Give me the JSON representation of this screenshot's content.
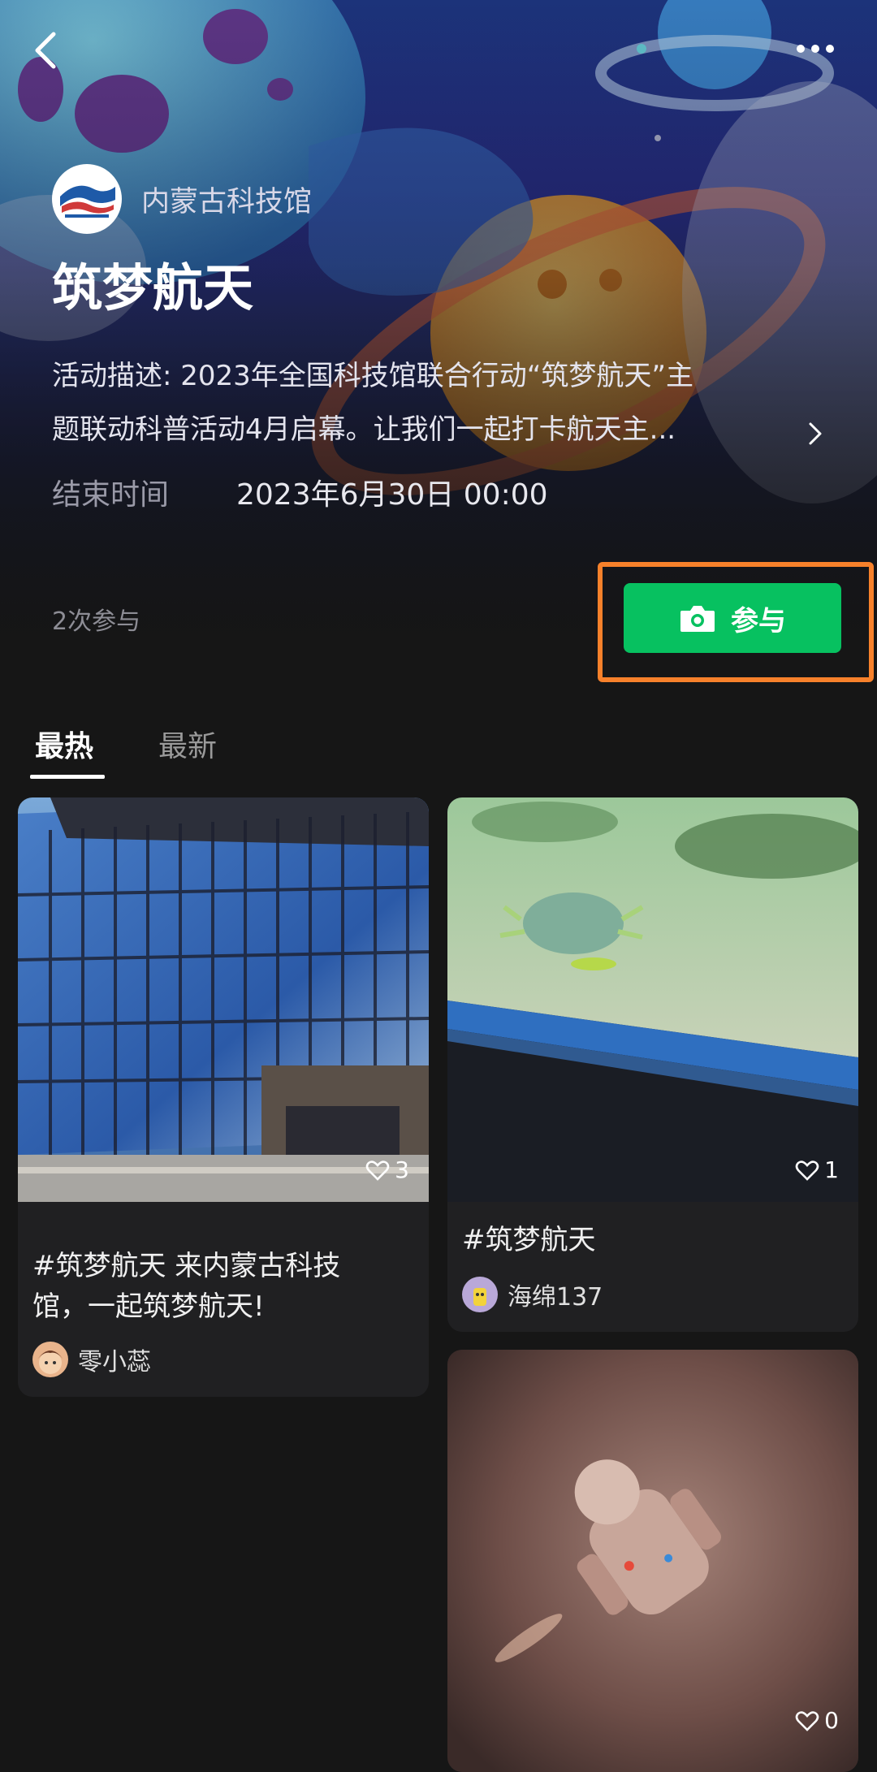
{
  "header": {
    "back_icon": "chevron-left-icon",
    "more_icon": "more-horizontal-icon"
  },
  "activity": {
    "organizer": "内蒙古科技馆",
    "title": "筑梦航天",
    "description_line1": "活动描述: 2023年全国科技馆联合行动“筑梦航天”主",
    "description_line2": "题联动科普活动4月启幕。让我们一起打卡航天主...",
    "end_time_label": "结束时间",
    "end_time_value": "2023年6月30日 00:00",
    "participation_count": "2次参与",
    "join_label": "参与"
  },
  "tabs": [
    {
      "label": "最热",
      "active": true
    },
    {
      "label": "最新",
      "active": false
    }
  ],
  "posts": [
    {
      "caption_line1": "#筑梦航天 来内蒙古科技",
      "caption_line2": "馆，一起筑梦航天!",
      "author": "零小蕊",
      "likes": "3"
    },
    {
      "caption_line1": "#筑梦航天",
      "author": "海绵137",
      "likes": "1"
    },
    {
      "likes": "0"
    }
  ],
  "colors": {
    "accent_green": "#07c160",
    "highlight_orange": "#f7812b",
    "background": "#161616"
  }
}
